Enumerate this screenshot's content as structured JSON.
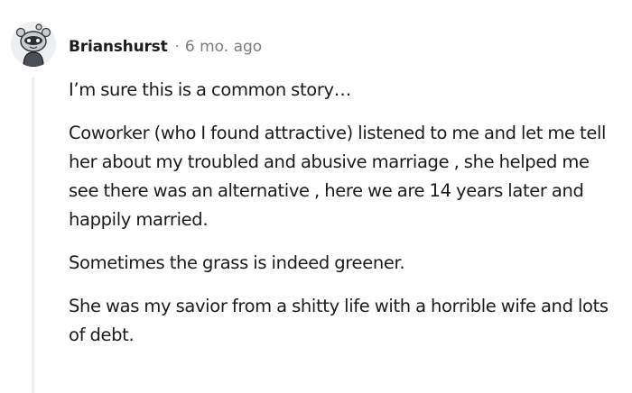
{
  "comment": {
    "author": "Brianshurst",
    "separator": "·",
    "timestamp": "6 mo. ago",
    "paragraphs": [
      "I’m sure this is a common story…",
      "Coworker (who I found attractive) listened to me and let me tell her about my troubled and abusive marriage , she helped me see there was an alternative , here we are 14 years later and happily married.",
      "Sometimes the grass is indeed greener.",
      "She was my savior from a shitty life with a horrible wife and lots of debt."
    ]
  },
  "icons": {
    "avatar": "reddit-snoo-avatar-icon"
  },
  "colors": {
    "avatar_bg": "#edeff1",
    "thread_line": "#edeff1",
    "text": "#1a1a1b",
    "meta_gray": "#7c7c7c"
  }
}
